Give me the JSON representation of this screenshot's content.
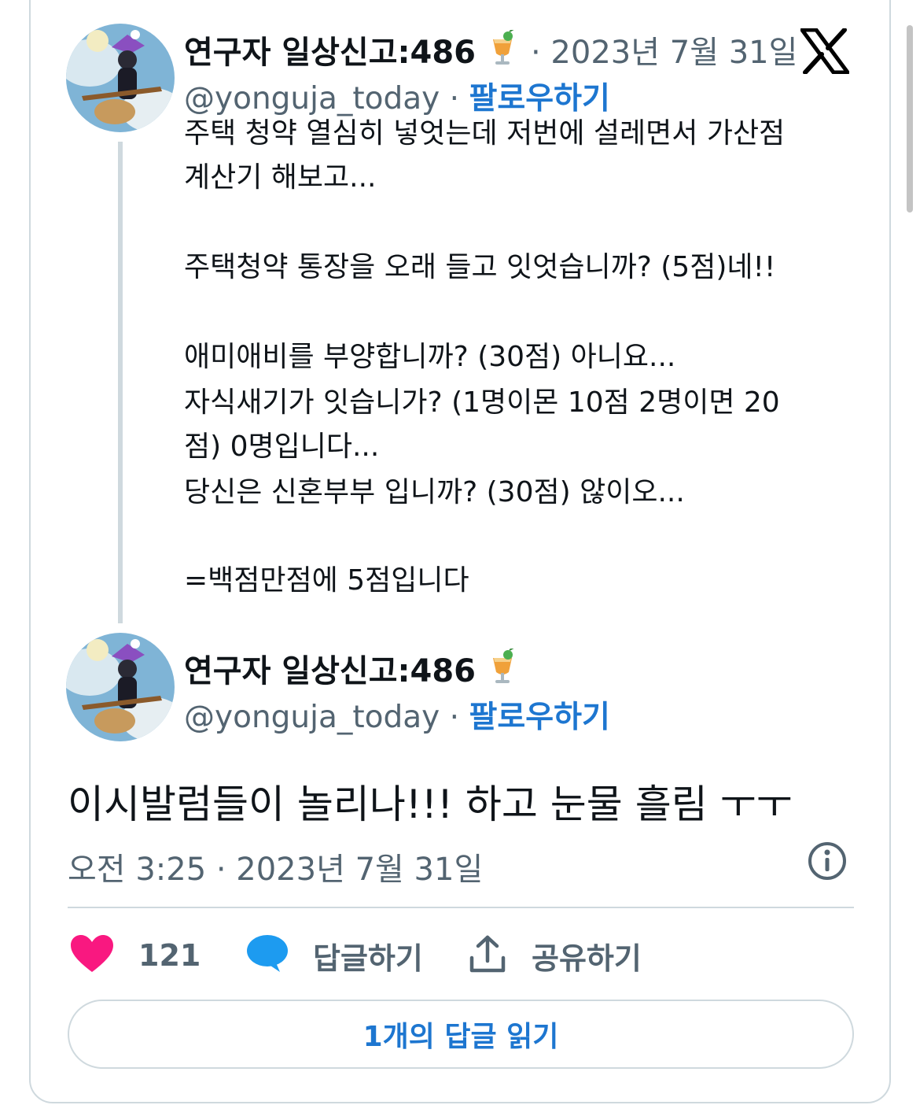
{
  "tweet1": {
    "display_name": "연구자 일상신고:486",
    "emoji_icon": "cocktail-icon",
    "date": "· 2023년 7월 31일",
    "handle": "@yonguja_today",
    "separator": "·",
    "follow_label": "팔로우하기",
    "lines": [
      "주택 청약 열심히 넣엇는데 저번에 설레면서 가산점",
      "계산기 해보고...",
      "",
      "주택청약 통장을 오래 들고 잇엇습니까?  (5점)네!!",
      "",
      "애미애비를 부양합니까?  (30점) 아니요...",
      "자식새기가 잇습니가? (1명이몬 10점 2명이면 20",
      "점)  0명입니다...",
      "당신은 신혼부부 입니까? (30점) 않이오...",
      "",
      "=백점만점에 5점입니다"
    ]
  },
  "tweet2": {
    "display_name": "연구자 일상신고:486",
    "emoji_icon": "cocktail-icon",
    "handle": "@yonguja_today",
    "separator": "·",
    "follow_label": "팔로우하기",
    "text": "이시발럼들이 놀리나!!! 하고 눈물 흘림 ㅜㅜ",
    "timestamp": "오전 3:25 · 2023년 7월 31일"
  },
  "actions": {
    "like_count": "121",
    "reply_label": "답글하기",
    "share_label": "공유하기",
    "read_replies_label": "1개의 답글 읽기"
  },
  "icons": [
    "x-logo-icon",
    "heart-icon",
    "speech-bubble-icon",
    "share-icon",
    "info-icon",
    "cocktail-icon",
    "avatar"
  ],
  "colors": {
    "like": "#f91880",
    "reply": "#1d9bf0",
    "link": "#1d76d0",
    "muted_text": "#536471",
    "border": "#cfd9de"
  }
}
